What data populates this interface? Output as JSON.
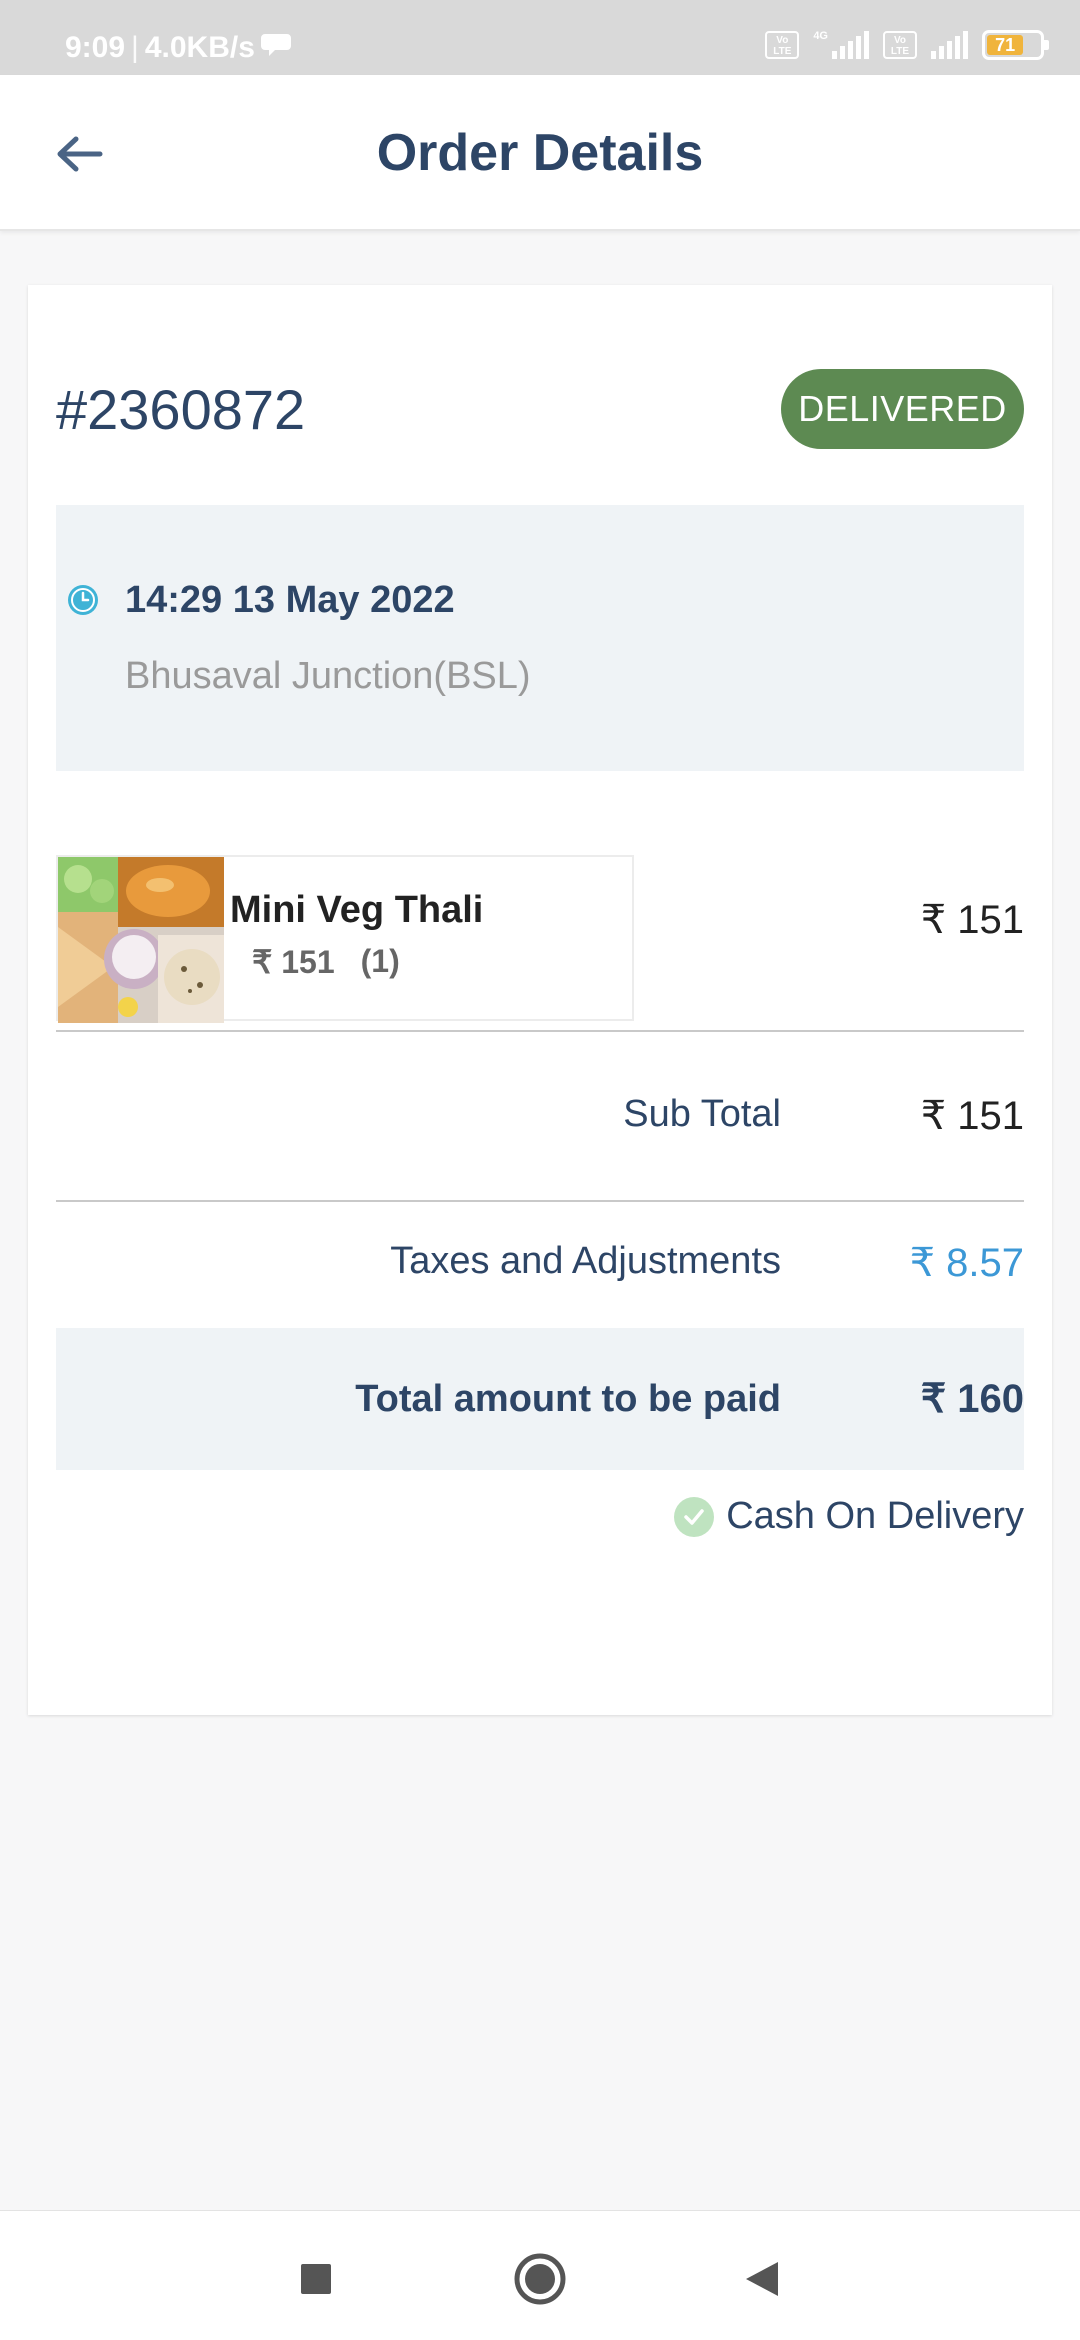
{
  "status_bar": {
    "time": "9:09",
    "net_speed": "4.0KB/s",
    "sim1_badge": "Vo LTE",
    "network_type": "4G",
    "sim2_badge": "Vo LTE",
    "battery_level": "71"
  },
  "header": {
    "title": "Order Details",
    "back_icon": "arrow-left-icon"
  },
  "order": {
    "id": "#2360872",
    "status": "DELIVERED",
    "status_color": "#5d8a52",
    "time": "14:29",
    "date": "13 May 2022",
    "station": "Bhusaval Junction(BSL)"
  },
  "item": {
    "name": "Mini Veg Thali",
    "unit_price": "₹ 151",
    "quantity": "(1)",
    "total": "₹ 151"
  },
  "summary": {
    "subtotal_label": "Sub Total",
    "subtotal_value": "₹ 151",
    "taxes_label": "Taxes and Adjustments",
    "taxes_value": "₹ 8.57",
    "taxes_color": "#3c98d6",
    "total_label": "Total amount to be paid",
    "total_value": "₹ 160"
  },
  "payment": {
    "method": "Cash On Delivery",
    "icon": "check-circle-icon"
  },
  "nav": {
    "recents_icon": "square-icon",
    "home_icon": "circle-icon",
    "back_icon": "triangle-back-icon"
  }
}
